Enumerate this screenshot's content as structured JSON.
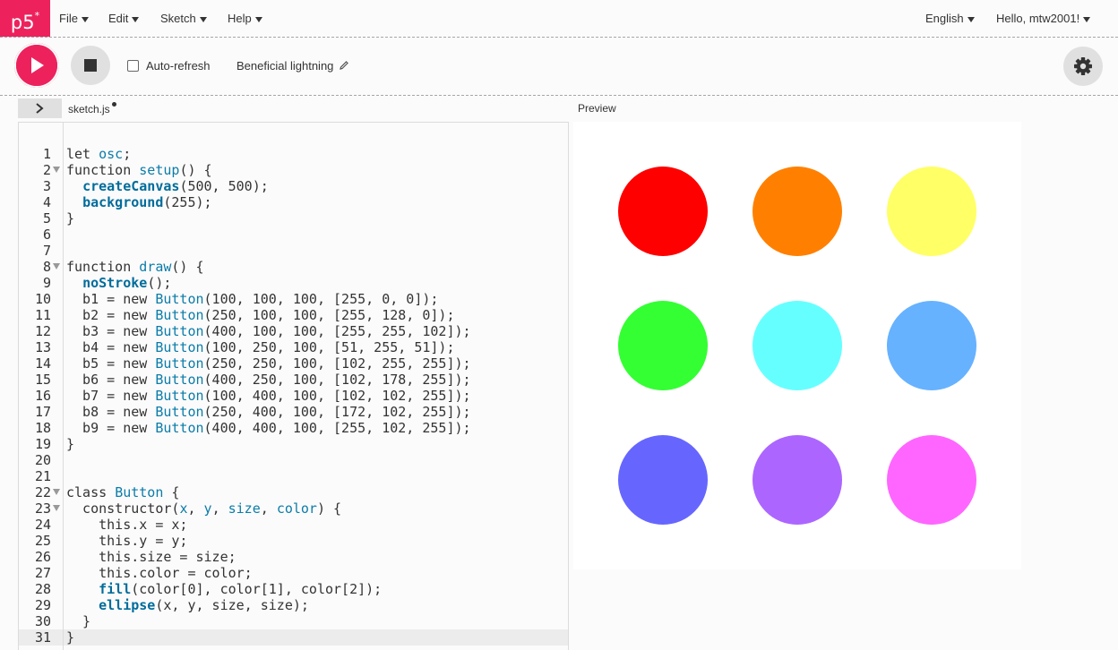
{
  "nav": {
    "logo": "p5",
    "logo_sup": "*",
    "menus": [
      "File",
      "Edit",
      "Sketch",
      "Help"
    ],
    "language": "English",
    "user": "Hello, mtw2001!"
  },
  "toolbar": {
    "auto_refresh_label": "Auto-refresh",
    "auto_refresh_checked": false,
    "sketch_name": "Beneficial lightning"
  },
  "editor": {
    "file_name": "sketch.js",
    "preview_label": "Preview",
    "active_line": 31,
    "lines": [
      {
        "n": "1",
        "t": "let osc;"
      },
      {
        "n": "2",
        "t": "function setup() {",
        "fold": true
      },
      {
        "n": "3",
        "t": "  createCanvas(500, 500);"
      },
      {
        "n": "4",
        "t": "  background(255);"
      },
      {
        "n": "5",
        "t": "}"
      },
      {
        "n": "6",
        "t": ""
      },
      {
        "n": "7",
        "t": ""
      },
      {
        "n": "8",
        "t": "function draw() {",
        "fold": true
      },
      {
        "n": "9",
        "t": "  noStroke();"
      },
      {
        "n": "10",
        "t": "  b1 = new Button(100, 100, 100, [255, 0, 0]);"
      },
      {
        "n": "11",
        "t": "  b2 = new Button(250, 100, 100, [255, 128, 0]);"
      },
      {
        "n": "12",
        "t": "  b3 = new Button(400, 100, 100, [255, 255, 102]);"
      },
      {
        "n": "13",
        "t": "  b4 = new Button(100, 250, 100, [51, 255, 51]);"
      },
      {
        "n": "14",
        "t": "  b5 = new Button(250, 250, 100, [102, 255, 255]);"
      },
      {
        "n": "15",
        "t": "  b6 = new Button(400, 250, 100, [102, 178, 255]);"
      },
      {
        "n": "16",
        "t": "  b7 = new Button(100, 400, 100, [102, 102, 255]);"
      },
      {
        "n": "17",
        "t": "  b8 = new Button(250, 400, 100, [172, 102, 255]);"
      },
      {
        "n": "18",
        "t": "  b9 = new Button(400, 400, 100, [255, 102, 255]);"
      },
      {
        "n": "19",
        "t": "}"
      },
      {
        "n": "20",
        "t": ""
      },
      {
        "n": "21",
        "t": ""
      },
      {
        "n": "22",
        "t": "class Button {",
        "fold": true
      },
      {
        "n": "23",
        "t": "  constructor(x, y, size, color) {",
        "fold": true
      },
      {
        "n": "24",
        "t": "    this.x = x;"
      },
      {
        "n": "25",
        "t": "    this.y = y;"
      },
      {
        "n": "26",
        "t": "    this.size = size;"
      },
      {
        "n": "27",
        "t": "    this.color = color;"
      },
      {
        "n": "28",
        "t": "    fill(color[0], color[1], color[2]);"
      },
      {
        "n": "29",
        "t": "    ellipse(x, y, size, size);"
      },
      {
        "n": "30",
        "t": "  }"
      },
      {
        "n": "31",
        "t": "}"
      }
    ]
  },
  "preview": {
    "canvas_background": "#ffffff",
    "circles": [
      {
        "color": "#ff0000"
      },
      {
        "color": "#ff8000"
      },
      {
        "color": "#ffff66"
      },
      {
        "color": "#33ff33"
      },
      {
        "color": "#66ffff"
      },
      {
        "color": "#66b2ff"
      },
      {
        "color": "#6666ff"
      },
      {
        "color": "#ac66ff"
      },
      {
        "color": "#ff66ff"
      }
    ]
  },
  "icons": {
    "play": "play-icon",
    "stop": "stop-icon",
    "settings": "gear-icon",
    "edit": "pencil-icon",
    "collapse": "chevron-right-icon"
  },
  "theme": {
    "accent": "#ed225d"
  }
}
